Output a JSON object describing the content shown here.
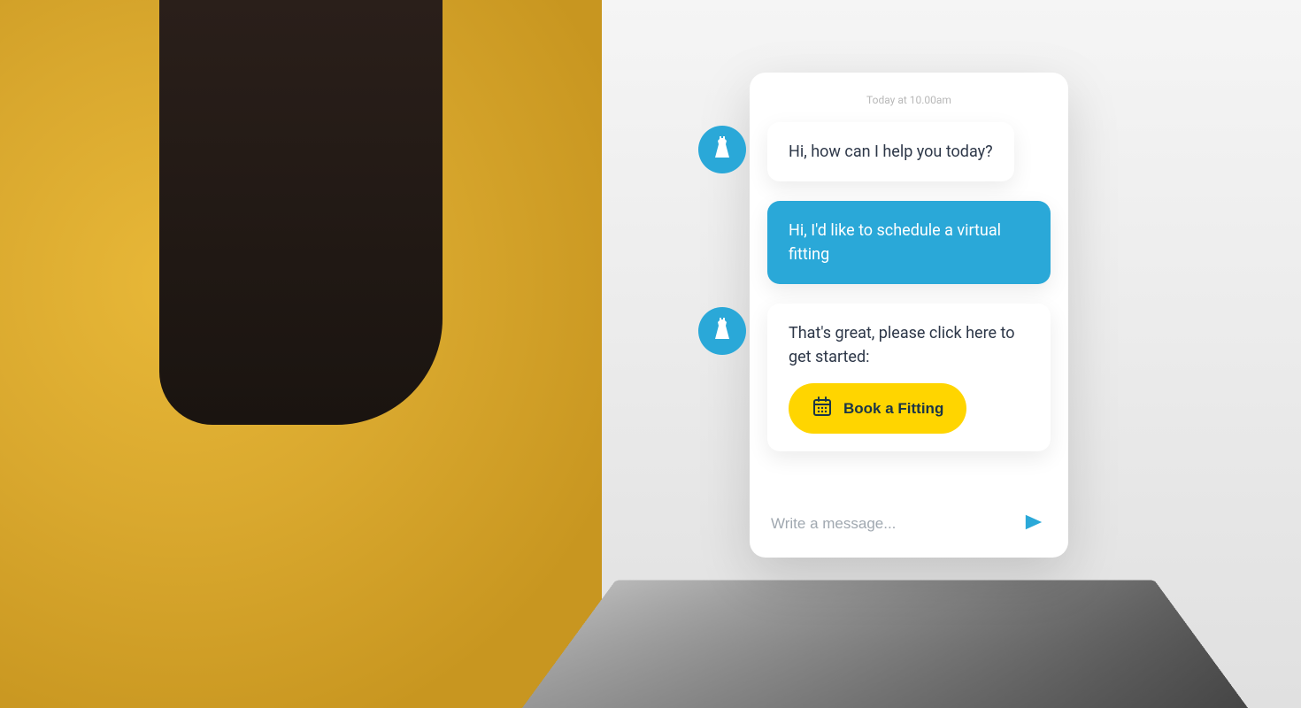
{
  "chat": {
    "timestamp": "Today at 10.00am",
    "messages": {
      "bot1": "Hi, how can I help you today?",
      "user1": "Hi, I'd like to schedule a virtual fitting",
      "bot2": "That's great, please click here to get started:"
    },
    "cta_label": "Book a Fitting",
    "input_placeholder": "Write a message...",
    "colors": {
      "accent": "#2aa8d8",
      "cta": "#ffd500"
    }
  }
}
